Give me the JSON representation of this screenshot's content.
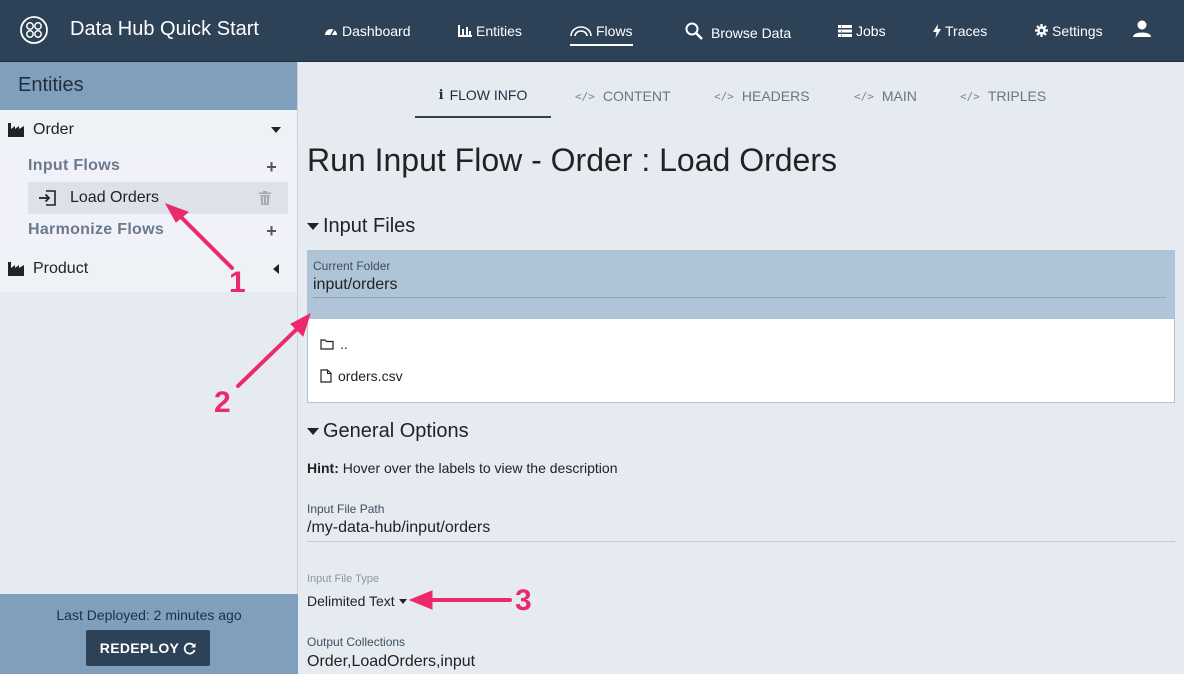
{
  "header": {
    "app_title": "Data Hub Quick Start",
    "nav": [
      {
        "label": "Dashboard",
        "icon": "dashboard-icon"
      },
      {
        "label": "Entities",
        "icon": "bar-chart-icon"
      },
      {
        "label": "Flows",
        "icon": "flows-arc-icon",
        "active": true
      },
      {
        "label": "Browse Data",
        "icon": "search-icon"
      },
      {
        "label": "Jobs",
        "icon": "list-icon"
      },
      {
        "label": "Traces",
        "icon": "bolt-icon"
      },
      {
        "label": "Settings",
        "icon": "gear-icon"
      }
    ],
    "user_icon": "user-icon"
  },
  "sidebar": {
    "title": "Entities",
    "entities": [
      {
        "name": "Order",
        "expanded": true
      },
      {
        "name": "Product",
        "expanded": false
      }
    ],
    "input_flows_label": "Input Flows",
    "input_flows": [
      "Load Orders"
    ],
    "harmonize_flows_label": "Harmonize Flows",
    "last_deployed": "Last Deployed: 2 minutes ago",
    "redeploy_label": "REDEPLOY"
  },
  "tabs": [
    {
      "label": "FLOW INFO",
      "icon": "info-icon",
      "active": true
    },
    {
      "label": "CONTENT",
      "icon": "code-icon"
    },
    {
      "label": "HEADERS",
      "icon": "code-icon"
    },
    {
      "label": "MAIN",
      "icon": "code-icon"
    },
    {
      "label": "TRIPLES",
      "icon": "code-icon"
    }
  ],
  "main": {
    "title": "Run Input Flow - Order : Load Orders",
    "input_files_heading": "Input Files",
    "current_folder_label": "Current Folder",
    "current_folder": "input/orders",
    "files": [
      {
        "name": "..",
        "type": "folder"
      },
      {
        "name": "orders.csv",
        "type": "file"
      }
    ],
    "general_options_heading": "General Options",
    "hint_bold": "Hint:",
    "hint_text": " Hover over the labels to view the description",
    "input_file_path_label": "Input File Path",
    "input_file_path": "/my-data-hub/input/orders",
    "input_file_type_label": "Input File Type",
    "input_file_type": "Delimited Text",
    "output_collections_label": "Output Collections",
    "output_collections": "Order,LoadOrders,input"
  },
  "annotations": {
    "labels": [
      "1",
      "2",
      "3"
    ],
    "color": "#ec2a6b"
  }
}
